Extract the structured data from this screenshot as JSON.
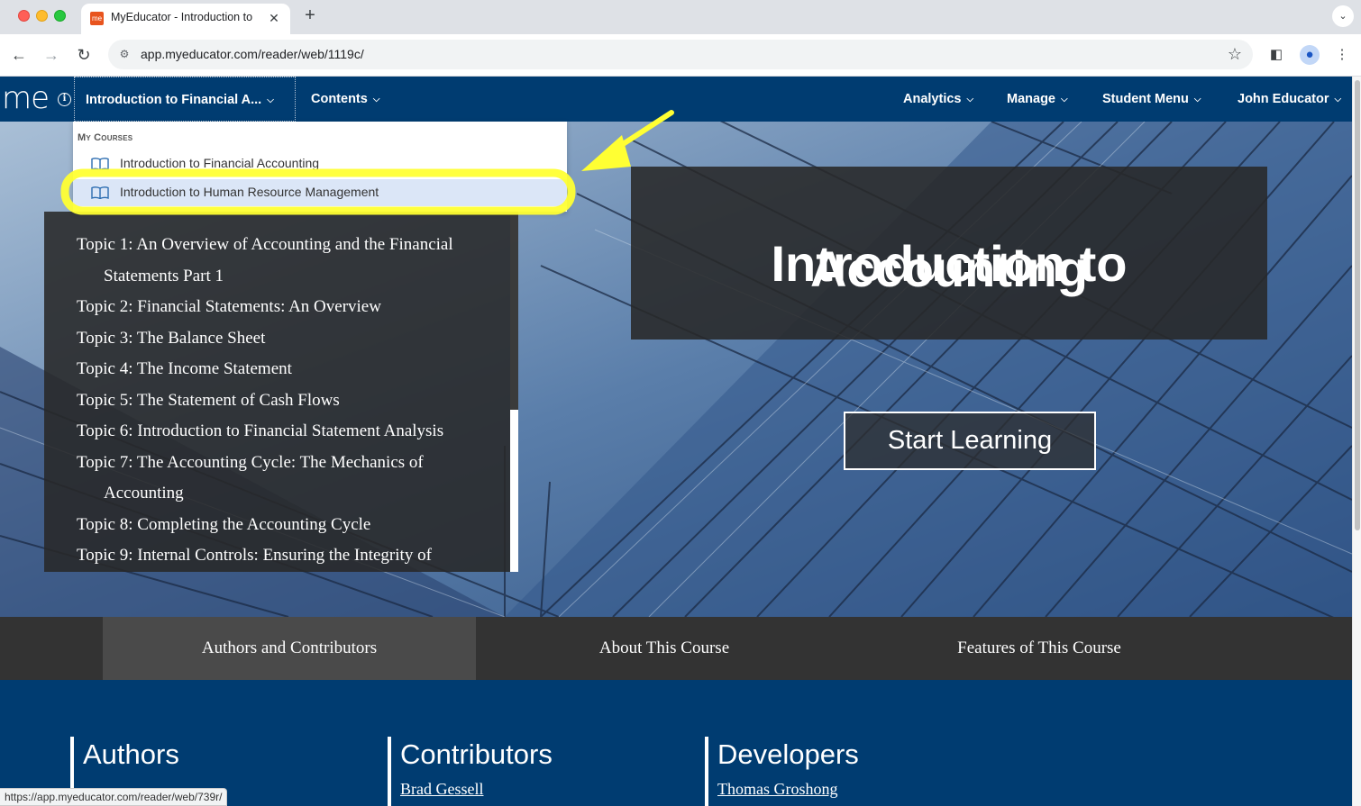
{
  "browser": {
    "tab_title": "MyEducator - Introduction to",
    "favicon_text": "me",
    "url": "app.myeducator.com/reader/web/1119c/",
    "status_url": "https://app.myeducator.com/reader/web/739r/"
  },
  "appnav": {
    "logo": "me",
    "course_label": "Introduction to Financial A...",
    "contents_label": "Contents",
    "analytics_label": "Analytics",
    "manage_label": "Manage",
    "student_menu_label": "Student Menu",
    "user_label": "John Educator"
  },
  "dropdown": {
    "header": "My Courses",
    "items": [
      {
        "label": "Introduction to Financial Accounting"
      },
      {
        "label": "Introduction to Human Resource Management"
      }
    ]
  },
  "hero": {
    "title_line1": "Introduction to",
    "title_line2": "Accounting",
    "start_button": "Start Learning"
  },
  "toc": {
    "items": [
      "Topic 1: An Overview of Accounting and the Financial Statements Part 1",
      "Topic 2: Financial Statements: An Overview",
      "Topic 3: The Balance Sheet",
      "Topic 4: The Income Statement",
      "Topic 5: The Statement of Cash Flows",
      "Topic 6: Introduction to Financial Statement Analysis",
      "Topic 7: The Accounting Cycle: The Mechanics of Accounting",
      "Topic 8: Completing the Accounting Cycle",
      "Topic 9: Internal Controls: Ensuring the Integrity of"
    ]
  },
  "info_tabs": [
    {
      "label": "Authors and Contributors"
    },
    {
      "label": "About This Course"
    },
    {
      "label": "Features of This Course"
    }
  ],
  "footer": {
    "authors_title": "Authors",
    "contributors_title": "Contributors",
    "contributors_first": "Brad Gessell",
    "developers_title": "Developers",
    "developers_first": "Thomas Groshong"
  },
  "colors": {
    "nav_bg": "#003c71",
    "highlight": "#ffff33",
    "dropdown_highlight": "#dbe6f7"
  }
}
